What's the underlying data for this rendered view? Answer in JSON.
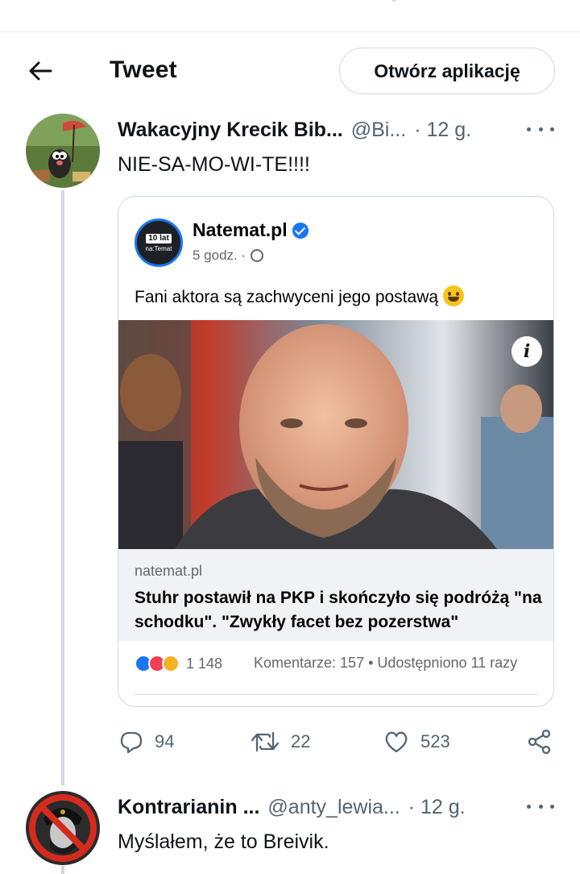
{
  "header": {
    "title": "Tweet",
    "open_app_label": "Otwórz aplikację"
  },
  "tweet": {
    "author_name": "Wakacyjny Krecik Bib...",
    "handle": "@Bi...",
    "time": "· 12 g.",
    "text": "NIE-SA-MO-WI-TE!!!!",
    "embed": {
      "page_name": "Natemat.pl",
      "logo_line1": "10 lat",
      "logo_line2": "na:Temat",
      "post_time": "5 godz. ·",
      "post_text": "Fani aktora są zachwyceni jego postawą",
      "info_label": "i",
      "link_domain": "natemat.pl",
      "link_title": "Stuhr postawił na PKP i skończyło się podróżą \"na schodku\". \"Zwykły facet bez pozerstwa\"",
      "reaction_count": "1 148",
      "stats": "Komentarze: 157 • Udostępniono 11 razy"
    },
    "actions": {
      "replies": "94",
      "retweets": "22",
      "likes": "523"
    }
  },
  "reply": {
    "author_name": "Kontrarianin ...",
    "handle": "@anty_lewia...",
    "time": "· 12 g.",
    "text": "Myślałem, że to Breivik."
  },
  "icons": {
    "back": "arrow-left-icon",
    "more": "more-horizontal-icon",
    "verified": "verified-badge-icon",
    "globe": "globe-icon",
    "reply": "reply-icon",
    "retweet": "retweet-icon",
    "like": "heart-icon",
    "share": "share-icon"
  },
  "colors": {
    "text_primary": "#0f1419",
    "text_secondary": "#536471",
    "border": "#cfd9de",
    "facebook_blue": "#1877f2"
  }
}
